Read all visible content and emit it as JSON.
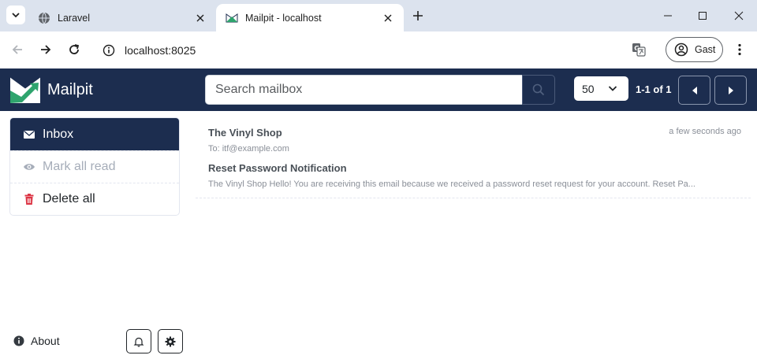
{
  "browser": {
    "tabs": [
      {
        "title": "Laravel",
        "active": false
      },
      {
        "title": "Mailpit - localhost",
        "active": true
      }
    ],
    "address": "localhost:8025",
    "profile_label": "Gast"
  },
  "app": {
    "name": "Mailpit",
    "search": {
      "placeholder": "Search mailbox",
      "value": ""
    },
    "per_page": "50",
    "count_text": "1-1 of 1",
    "colors": {
      "header": "#1c2d4f",
      "logo_green": "#2ea46d",
      "danger": "#dc3545"
    }
  },
  "sidebar": {
    "items": [
      {
        "label": "Inbox",
        "icon": "envelope-icon"
      },
      {
        "label": "Mark all read",
        "icon": "eye-icon"
      },
      {
        "label": "Delete all",
        "icon": "trash-icon"
      }
    ],
    "about_label": "About"
  },
  "messages": [
    {
      "subject": "The Vinyl Shop",
      "meta": "To: itf@example.com",
      "time": "a few seconds ago"
    },
    {
      "subject": "Reset Password Notification",
      "meta": "The Vinyl Shop Hello! You are receiving this email because we received a password reset request for your account. Reset Pa...",
      "time": ""
    }
  ]
}
